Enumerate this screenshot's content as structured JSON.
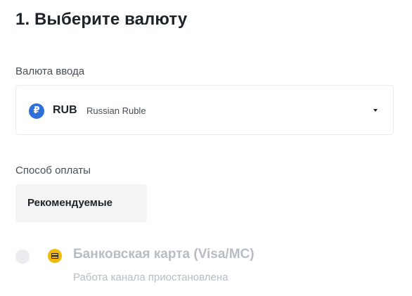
{
  "step": {
    "title": "1. Выберите валюту"
  },
  "currency": {
    "label": "Валюта ввода",
    "selected": {
      "icon": "ruble-icon",
      "icon_glyph": "₽",
      "code": "RUB",
      "name": "Russian Ruble"
    },
    "dropdown_icon": "caret-down-icon"
  },
  "payment": {
    "label": "Способ оплаты",
    "tabs": [
      {
        "label": "Рекомендуемые",
        "active": true
      }
    ],
    "methods": [
      {
        "icon": "bank-card-icon",
        "name": "Банковская карта (Visa/MC)",
        "status": "Работа канала приостановлена",
        "disabled": true
      }
    ]
  },
  "colors": {
    "text_primary": "#1e2329",
    "text_secondary": "#474d57",
    "text_disabled": "#b7bdc6",
    "ruble_badge": "#2f6fd8",
    "card_icon_bg": "#f0b90b",
    "tab_bg": "#f5f5f5",
    "border": "#eaecef"
  }
}
